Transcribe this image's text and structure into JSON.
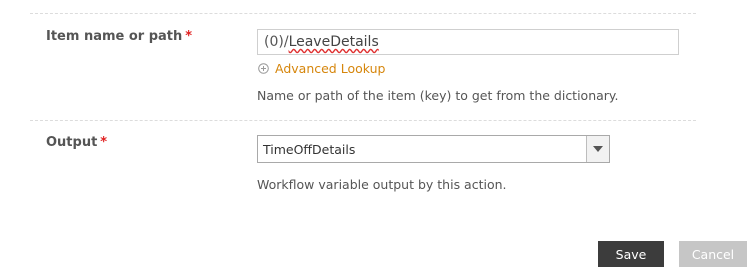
{
  "form": {
    "item_field": {
      "label": "Item name or path",
      "required_marker": "*",
      "value_prefix": "(0)/",
      "value_main": "LeaveDetails",
      "advanced_lookup_label": "Advanced Lookup",
      "hint": "Name or path of the item (key) to get from the dictionary."
    },
    "output_field": {
      "label": "Output",
      "required_marker": "*",
      "selected": "TimeOffDetails",
      "hint": "Workflow variable output by this action."
    }
  },
  "actions": {
    "save_label": "Save",
    "cancel_label": "Cancel"
  },
  "colors": {
    "required": "#e02020",
    "link": "#d6860c",
    "save_bg": "#3c3c3c",
    "cancel_bg": "#c6c6c6"
  },
  "icons": {
    "lookup": "plus-circle-icon",
    "dropdown": "caret-down-icon"
  }
}
